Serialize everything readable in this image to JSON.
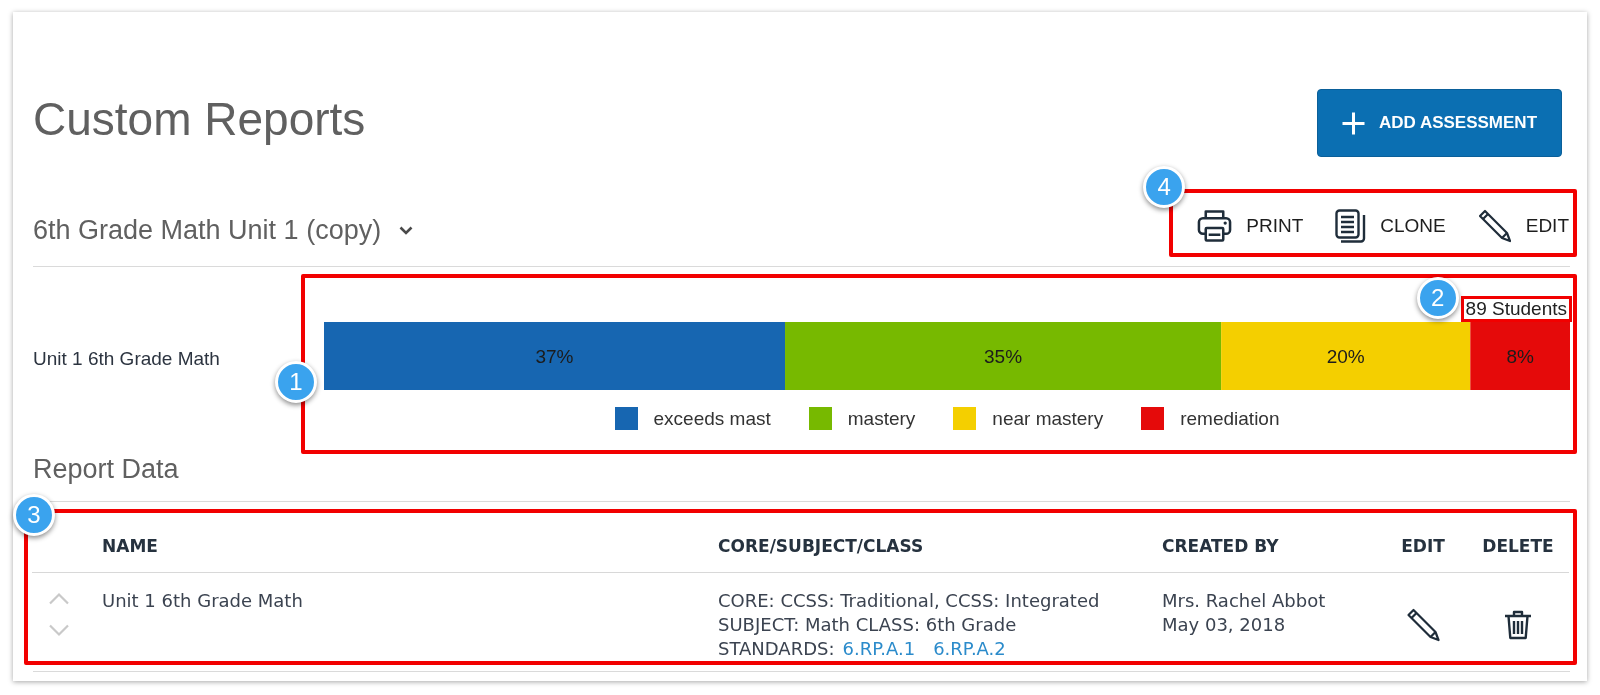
{
  "page": {
    "title": "Custom Reports",
    "add_button": {
      "label": "ADD ASSESSMENT"
    }
  },
  "report_selector": {
    "value": "6th Grade Math Unit 1 (copy)"
  },
  "toolbar": {
    "callout": "4",
    "actions": [
      {
        "kind": "print",
        "label": "PRINT"
      },
      {
        "kind": "clone",
        "label": "CLONE"
      },
      {
        "kind": "edit",
        "label": "EDIT"
      }
    ]
  },
  "summary": {
    "callout": "1",
    "student_count": {
      "text": "89 Students",
      "callout": "2"
    },
    "chart_data": {
      "type": "bar",
      "orientation": "horizontal",
      "stacked": true,
      "categories": [
        "Unit 1 6th Grade Math"
      ],
      "series": [
        {
          "name": "exceeds mast",
          "color": "#1766b1",
          "values": [
            37
          ],
          "value_labels": [
            "37%"
          ]
        },
        {
          "name": "mastery",
          "color": "#77b900",
          "values": [
            35
          ],
          "value_labels": [
            "35%"
          ]
        },
        {
          "name": "near mastery",
          "color": "#f4cf00",
          "values": [
            20
          ],
          "value_labels": [
            "20%"
          ]
        },
        {
          "name": "remediation",
          "color": "#e50a0a",
          "values": [
            8
          ],
          "value_labels": [
            "8%"
          ]
        }
      ],
      "legend": true
    }
  },
  "report_data": {
    "heading": "Report Data",
    "callout": "3",
    "columns": [
      "NAME",
      "CORE/SUBJECT/CLASS",
      "CREATED BY",
      "EDIT",
      "DELETE"
    ],
    "rows": [
      {
        "name": "Unit 1 6th Grade Math",
        "core": "CORE: CCSS: Traditional, CCSS: Integrated",
        "subject_class": "SUBJECT: Math CLASS: 6th Grade",
        "standards_label": "STANDARDS:",
        "standards": [
          "6.RP.A.1",
          "6.RP.A.2"
        ],
        "created_by": "Mrs. Rachel Abbot",
        "created_on": "May 03, 2018"
      }
    ]
  }
}
